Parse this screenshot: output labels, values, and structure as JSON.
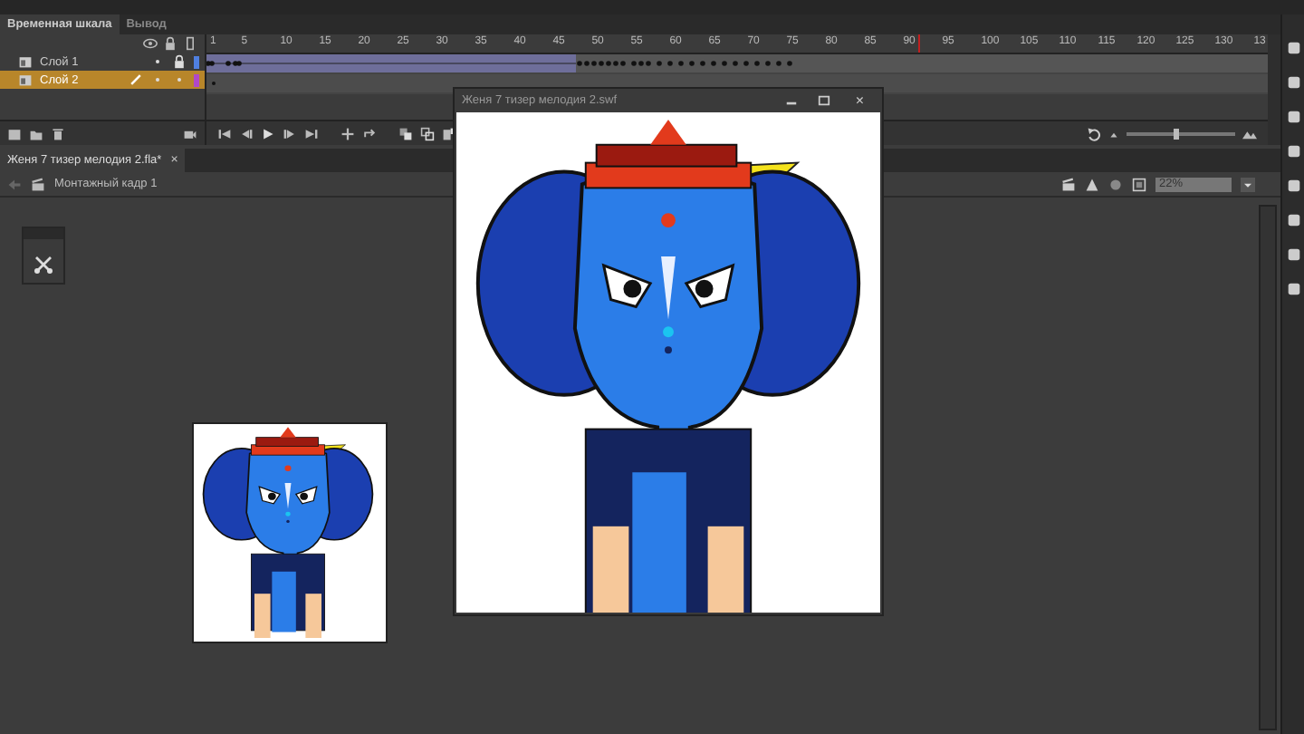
{
  "timeline_panel": {
    "tabs": [
      {
        "label": "Временная шкала",
        "selected": true
      },
      {
        "label": "Вывод",
        "selected": false
      }
    ],
    "ruler": {
      "frames": [
        "1",
        "5",
        "10",
        "15",
        "20",
        "25",
        "30",
        "35",
        "40",
        "45",
        "50",
        "55",
        "60",
        "65",
        "70",
        "75",
        "80",
        "85",
        "90",
        "95",
        "100",
        "105",
        "110",
        "115",
        "120",
        "125",
        "130",
        "13"
      ]
    },
    "playhead": {
      "level": 0.67
    },
    "layers": [
      {
        "name": "Слой 1",
        "selected": false,
        "locked": true,
        "color": "#4f7fe0"
      },
      {
        "name": "Слой 2",
        "selected": true,
        "locked": false,
        "color": "#b048c8"
      }
    ],
    "zoom_slider": {
      "level": 0.45
    }
  },
  "document_tab": {
    "title": "Женя 7 тизер мелодия 2.fla*",
    "close": "×"
  },
  "edit_bar": {
    "scene": "Монтажный кадр 1",
    "zoom": "22%"
  },
  "swf_window": {
    "title": "Женя 7 тизер мелодия 2.swf",
    "close": "×"
  }
}
